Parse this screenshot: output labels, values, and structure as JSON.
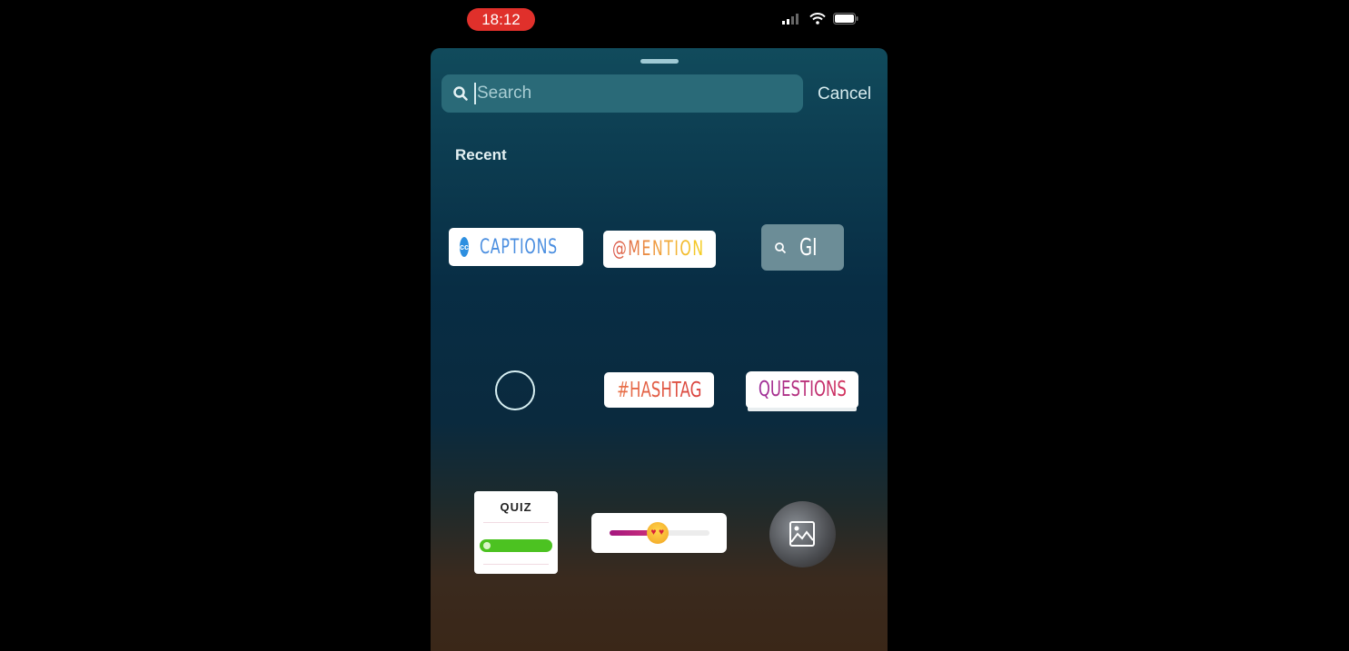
{
  "status_bar": {
    "time": "18:12",
    "icons": [
      "signal-icon",
      "wifi-icon",
      "battery-icon"
    ],
    "time_pill_color": "#e0302b"
  },
  "search": {
    "placeholder": "Search",
    "value": "",
    "cancel_label": "Cancel"
  },
  "section": {
    "title": "Recent"
  },
  "stickers": {
    "captions": {
      "label": "CAPTIONS",
      "icon": "cc-icon",
      "icon_text": "cc"
    },
    "mention": {
      "label": "@MENTION"
    },
    "gif": {
      "label": "GI",
      "icon": "search-icon"
    },
    "countdown": {
      "icon": "circle-icon"
    },
    "hashtag": {
      "label": "#HASHTAG"
    },
    "questions": {
      "label": "QUESTIONS"
    },
    "quiz": {
      "label": "QUIZ",
      "icon": "check-icon"
    },
    "emoji_slider": {
      "emoji": "heart-eyes-emoji",
      "value_percent": 48
    },
    "photo": {
      "icon": "image-icon"
    }
  },
  "colors": {
    "captions_blue": "#4a8ee0",
    "quiz_green": "#4cc221",
    "slider_magenta": "#a3167e"
  }
}
